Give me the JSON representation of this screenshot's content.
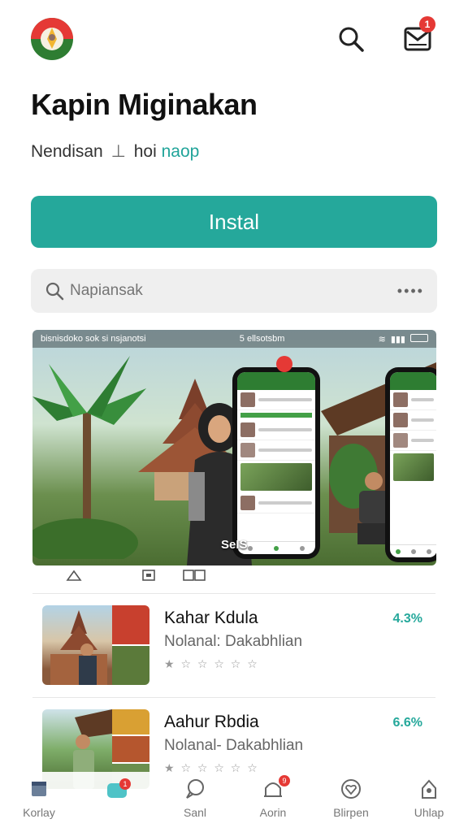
{
  "header": {
    "logo_icon": "app-logo-emblem",
    "search_icon": "search-icon",
    "inbox_icon": "inbox-icon",
    "inbox_badge": "1"
  },
  "app": {
    "title": "Kapin Miginakan",
    "subtitle_main": "Nendisan",
    "subtitle_sep": "⊥",
    "subtitle_part": "hoi",
    "subtitle_accent": "naop",
    "install_label": "Instal"
  },
  "search": {
    "placeholder": "Napiansak",
    "more": "••••"
  },
  "hero": {
    "status_left": "bisnisdoko sok si nsjanotsi",
    "status_mid": "5 ellsotsbm",
    "label": "SeIS"
  },
  "list": [
    {
      "title": "Kahar Kdula",
      "subtitle": "Nolanal: Dakabhlian",
      "stars": "★ ☆ ☆ ☆ ☆ ☆",
      "value": "4.3%"
    },
    {
      "title": "Aahur Rbdia",
      "subtitle": "Nolanal- Dakabhlian",
      "stars": "★ ☆ ☆ ☆ ☆ ☆",
      "value": "6.6%"
    }
  ],
  "bottom_nav": [
    {
      "label": "Korlay",
      "icon": "home-icon"
    },
    {
      "label": "",
      "icon": "apps-icon",
      "badge": "1"
    },
    {
      "label": "Sanl",
      "icon": "chat-icon"
    },
    {
      "label": "Aorin",
      "icon": "notification-icon",
      "badge": "9"
    },
    {
      "label": "Blirpen",
      "icon": "heart-icon"
    },
    {
      "label": "Uhlap",
      "icon": "profile-icon"
    }
  ],
  "colors": {
    "accent": "#25a89b",
    "badge": "#e53935"
  }
}
